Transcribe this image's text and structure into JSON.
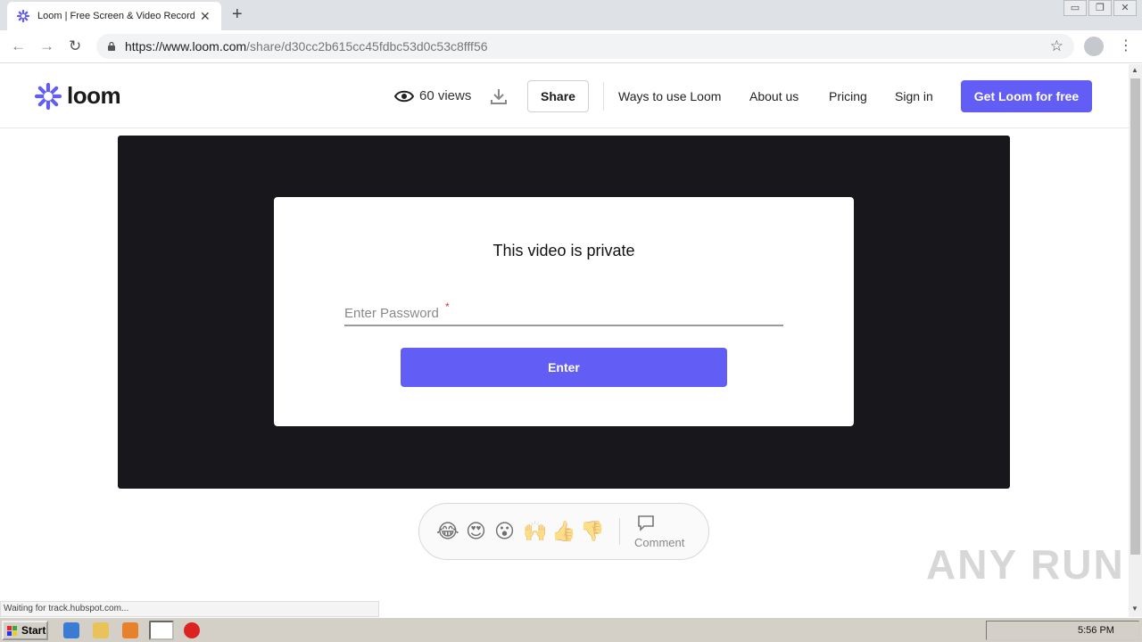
{
  "browser": {
    "tab_title": "Loom | Free Screen & Video Recording",
    "tab_close": "✕",
    "new_tab": "+",
    "url_host": "https://www.loom.com",
    "url_path": "/share/d30cc2b615cc45fdbc53d0c53c8fff56",
    "window_controls": [
      "▭",
      "❐",
      "✕"
    ]
  },
  "header": {
    "logo_text": "loom",
    "views_label": "60 views",
    "share_label": "Share",
    "nav": [
      "Ways to use Loom",
      "About us",
      "Pricing",
      "Sign in"
    ],
    "cta_label": "Get Loom for free",
    "brand_color": "#625df5"
  },
  "modal": {
    "title": "This video is private",
    "password_placeholder": "Enter Password",
    "required_mark": "*",
    "enter_label": "Enter"
  },
  "reactions": {
    "emojis": [
      "😂",
      "😍",
      "😮",
      "🙌",
      "👍",
      "👎"
    ],
    "comment_label": "Comment"
  },
  "status": {
    "text": "Waiting for track.hubspot.com..."
  },
  "watermark": "ANY RUN",
  "taskbar": {
    "start_label": "Start",
    "clock": "5:56 PM"
  }
}
